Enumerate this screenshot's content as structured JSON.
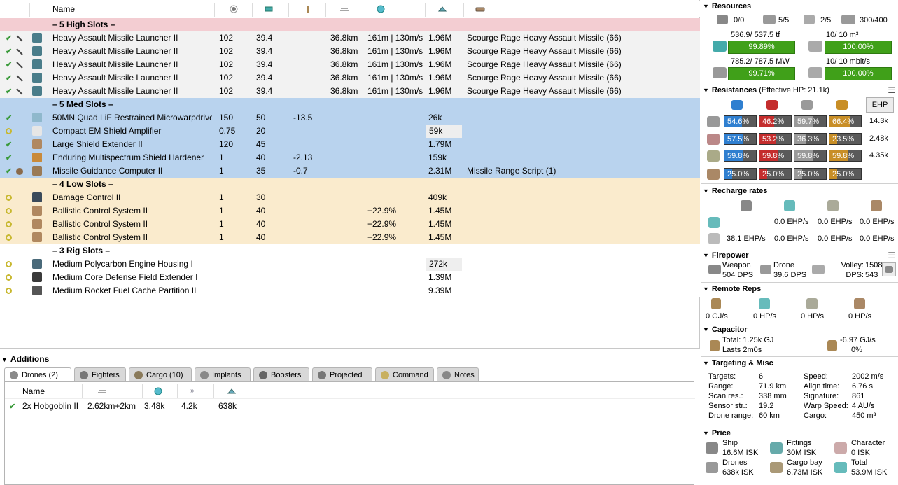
{
  "fitting": {
    "header": {
      "name": "Name"
    },
    "groups": [
      {
        "title": "– 5 High Slots –",
        "style": "hi",
        "rows": [
          {
            "state": "check",
            "name": "Heavy Assault Missile Launcher II",
            "cpu": "102",
            "pg": "39.4",
            "cap": "",
            "range": "36.8km",
            "track": "161m | 130m/s",
            "price": "1.96M",
            "charge": "Scourge Rage Heavy Assault Missile (66)"
          },
          {
            "state": "check",
            "name": "Heavy Assault Missile Launcher II",
            "cpu": "102",
            "pg": "39.4",
            "cap": "",
            "range": "36.8km",
            "track": "161m | 130m/s",
            "price": "1.96M",
            "charge": "Scourge Rage Heavy Assault Missile (66)"
          },
          {
            "state": "check",
            "name": "Heavy Assault Missile Launcher II",
            "cpu": "102",
            "pg": "39.4",
            "cap": "",
            "range": "36.8km",
            "track": "161m | 130m/s",
            "price": "1.96M",
            "charge": "Scourge Rage Heavy Assault Missile (66)"
          },
          {
            "state": "check",
            "name": "Heavy Assault Missile Launcher II",
            "cpu": "102",
            "pg": "39.4",
            "cap": "",
            "range": "36.8km",
            "track": "161m | 130m/s",
            "price": "1.96M",
            "charge": "Scourge Rage Heavy Assault Missile (66)"
          },
          {
            "state": "check",
            "name": "Heavy Assault Missile Launcher II",
            "cpu": "102",
            "pg": "39.4",
            "cap": "",
            "range": "36.8km",
            "track": "161m | 130m/s",
            "price": "1.96M",
            "charge": "Scourge Rage Heavy Assault Missile (66)"
          }
        ]
      },
      {
        "title": "– 5 Med Slots –",
        "style": "med",
        "rows": [
          {
            "state": "check",
            "name": "50MN Quad LiF Restrained Microwarpdrive",
            "cpu": "150",
            "pg": "50",
            "cap": "-13.5",
            "range": "",
            "track": "",
            "price": "26k",
            "charge": ""
          },
          {
            "state": "offline",
            "name": "Compact EM Shield Amplifier",
            "cpu": "0.75",
            "pg": "20",
            "cap": "",
            "range": "",
            "track": "",
            "price": "59k",
            "charge": "",
            "hl": true
          },
          {
            "state": "check",
            "name": "Large Shield Extender II",
            "cpu": "120",
            "pg": "45",
            "cap": "",
            "range": "",
            "track": "",
            "price": "1.79M",
            "charge": ""
          },
          {
            "state": "check",
            "name": "Enduring Multispectrum Shield Hardener",
            "cpu": "1",
            "pg": "40",
            "cap": "-2.13",
            "range": "",
            "track": "",
            "price": "159k",
            "charge": ""
          },
          {
            "state": "check",
            "name": "Missile Guidance Computer II",
            "cpu": "1",
            "pg": "35",
            "cap": "-0.7",
            "range": "",
            "track": "",
            "price": "2.31M",
            "charge": "Missile Range Script (1)"
          }
        ]
      },
      {
        "title": "– 4 Low Slots –",
        "style": "low",
        "rows": [
          {
            "state": "offline",
            "name": "Damage Control II",
            "cpu": "1",
            "pg": "30",
            "cap": "",
            "range": "",
            "track": "",
            "price": "409k",
            "charge": ""
          },
          {
            "state": "offline",
            "name": "Ballistic Control System II",
            "cpu": "1",
            "pg": "40",
            "cap": "",
            "range": "",
            "track": "+22.9%",
            "price": "1.45M",
            "charge": ""
          },
          {
            "state": "offline",
            "name": "Ballistic Control System II",
            "cpu": "1",
            "pg": "40",
            "cap": "",
            "range": "",
            "track": "+22.9%",
            "price": "1.45M",
            "charge": ""
          },
          {
            "state": "offline",
            "name": "Ballistic Control System II",
            "cpu": "1",
            "pg": "40",
            "cap": "",
            "range": "",
            "track": "+22.9%",
            "price": "1.45M",
            "charge": ""
          }
        ]
      },
      {
        "title": "– 3 Rig Slots –",
        "style": "rig",
        "rows": [
          {
            "state": "offline",
            "name": "Medium Polycarbon Engine Housing I",
            "cpu": "",
            "pg": "",
            "cap": "",
            "range": "",
            "track": "",
            "price": "272k",
            "charge": "",
            "hl": true
          },
          {
            "state": "offline",
            "name": "Medium Core Defense Field Extender I",
            "cpu": "",
            "pg": "",
            "cap": "",
            "range": "",
            "track": "",
            "price": "1.39M",
            "charge": ""
          },
          {
            "state": "offline",
            "name": "Medium Rocket Fuel Cache Partition II",
            "cpu": "",
            "pg": "",
            "cap": "",
            "range": "",
            "track": "",
            "price": "9.39M",
            "charge": ""
          }
        ]
      }
    ]
  },
  "additions": {
    "title": "Additions",
    "tabs": [
      "Drones (2)",
      "Fighters",
      "Cargo (10)",
      "Implants",
      "Boosters",
      "Projected",
      "Command",
      "Notes"
    ],
    "drone_header": {
      "name": "Name"
    },
    "drones": [
      {
        "name": "2x Hobgoblin II",
        "range": "2.62km+2km",
        "hp": "3.48k",
        "speed": "4.2k",
        "price": "638k"
      }
    ]
  },
  "stats": {
    "resources": {
      "title": "Resources",
      "counts": [
        "0/0",
        "5/5",
        "2/5",
        "300/400"
      ],
      "cpu_text": "536.9/ 537.5 tf",
      "cpu_pct": "99.89%",
      "cpu_fill": 0.9989,
      "pg_text": "785.2/ 787.5 MW",
      "pg_pct": "99.71%",
      "pg_fill": 0.9971,
      "drone_bay_text": "10/ 10 m³",
      "drone_bay_pct": "100.00%",
      "bandwidth_text": "10/ 10 mbit/s",
      "bandwidth_pct": "100.00%"
    },
    "resistances": {
      "title": "Resistances",
      "ehp": "(Effective HP: 21.1k)",
      "ehp_button": "EHP",
      "rows": [
        {
          "vals": [
            "54.6%",
            "46.2%",
            "59.7%",
            "66.4%"
          ],
          "fills": [
            0.546,
            0.462,
            0.597,
            0.664
          ],
          "hp": "14.3k"
        },
        {
          "vals": [
            "57.5%",
            "53.2%",
            "36.3%",
            "23.5%"
          ],
          "fills": [
            0.575,
            0.532,
            0.363,
            0.235
          ],
          "hp": "2.48k"
        },
        {
          "vals": [
            "59.8%",
            "59.8%",
            "59.8%",
            "59.8%"
          ],
          "fills": [
            0.598,
            0.598,
            0.598,
            0.598
          ],
          "hp": "4.35k"
        },
        {
          "vals": [
            "25.0%",
            "25.0%",
            "25.0%",
            "25.0%"
          ],
          "fills": [
            0.25,
            0.25,
            0.25,
            0.25
          ],
          "hp": ""
        }
      ]
    },
    "recharge": {
      "title": "Recharge rates",
      "row1": [
        "0.0 EHP/s",
        "0.0 EHP/s",
        "0.0 EHP/s"
      ],
      "row2": [
        "38.1 EHP/s",
        "0.0 EHP/s",
        "0.0 EHP/s",
        "0.0 EHP/s"
      ]
    },
    "firepower": {
      "title": "Firepower",
      "weapon_label": "Weapon",
      "weapon_dps": "504 DPS",
      "drone_label": "Drone",
      "drone_dps": "39.6 DPS",
      "volley_label": "Volley:",
      "volley": "1508",
      "dps_label": "DPS:",
      "dps": "543"
    },
    "remote": {
      "title": "Remote Reps",
      "vals": [
        "0 GJ/s",
        "0 HP/s",
        "0 HP/s",
        "0 HP/s"
      ]
    },
    "capacitor": {
      "title": "Capacitor",
      "total": "Total: 1.25k GJ",
      "lasts": "Lasts 2m0s",
      "delta": "-6.97 GJ/s",
      "pct": "0%"
    },
    "targeting": {
      "title": "Targeting & Misc",
      "left": [
        {
          "k": "Targets:",
          "v": "6"
        },
        {
          "k": "Range:",
          "v": "71.9 km"
        },
        {
          "k": "Scan res.:",
          "v": "338 mm"
        },
        {
          "k": "Sensor str.:",
          "v": "19.2"
        },
        {
          "k": "Drone range:",
          "v": "60 km"
        }
      ],
      "right": [
        {
          "k": "Speed:",
          "v": "2002 m/s"
        },
        {
          "k": "Align time:",
          "v": "6.76 s"
        },
        {
          "k": "Signature:",
          "v": "861"
        },
        {
          "k": "Warp Speed:",
          "v": "4 AU/s"
        },
        {
          "k": "Cargo:",
          "v": "450 m³"
        }
      ]
    },
    "price": {
      "title": "Price",
      "items": [
        {
          "k": "Ship",
          "v": "16.6M ISK"
        },
        {
          "k": "Fittings",
          "v": "30M ISK"
        },
        {
          "k": "Character",
          "v": "0 ISK"
        },
        {
          "k": "Drones",
          "v": "638k ISK"
        },
        {
          "k": "Cargo bay",
          "v": "6.73M ISK"
        },
        {
          "k": "Total",
          "v": "53.9M ISK"
        }
      ]
    }
  },
  "colors": {
    "high": "#f3cdd2",
    "med": "#b9d3ee",
    "low": "#faebcd",
    "bar_green": "#40a019",
    "em": "#2f7fd0",
    "thermal": "#c42d2d",
    "kinetic": "#9a9a9a",
    "explosive": "#c88e26"
  }
}
